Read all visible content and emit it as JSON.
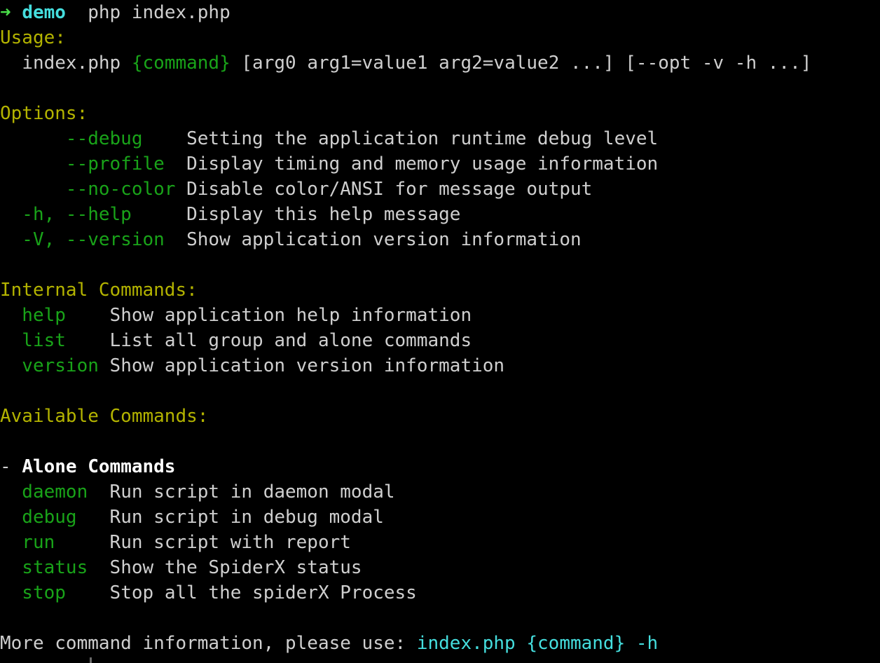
{
  "terminal": {
    "background": "#000000",
    "foreground": "#cfcfcf",
    "prompt": {
      "arrow_icon": "➜",
      "host": "demo",
      "command": "php index.php"
    },
    "cursor": {
      "visible": true,
      "color": "#6a6a6a"
    }
  },
  "colors": {
    "heading": "#b3b300",
    "flag": "#19a319",
    "command": "#19a319",
    "text": "#cfcfcf",
    "accent_cyan": "#45dede",
    "group_title": "#ffffff",
    "prompt_arrow": "#4ae04a",
    "prompt_host": "#45dede"
  },
  "usage": {
    "heading": "Usage:",
    "indent": "  ",
    "script": "index.php ",
    "command_token": "{command}",
    "args": " [arg0 arg1=value1 arg2=value2 ...] [--opt -v -h ...]"
  },
  "options": {
    "heading": "Options:",
    "items": [
      {
        "flags": "      --debug    ",
        "description": "Setting the application runtime debug level"
      },
      {
        "flags": "      --profile  ",
        "description": "Display timing and memory usage information"
      },
      {
        "flags": "      --no-color ",
        "description": "Disable color/ANSI for message output"
      },
      {
        "flags": "  -h, --help     ",
        "description": "Display this help message"
      },
      {
        "flags": "  -V, --version  ",
        "description": "Show application version information"
      }
    ]
  },
  "internal_commands": {
    "heading": "Internal Commands:",
    "items": [
      {
        "name": "  help    ",
        "description": "Show application help information"
      },
      {
        "name": "  list    ",
        "description": "List all group and alone commands"
      },
      {
        "name": "  version ",
        "description": "Show application version information"
      }
    ]
  },
  "available_commands": {
    "heading": "Available Commands:",
    "groups": [
      {
        "bullet": "- ",
        "title": "Alone Commands",
        "items": [
          {
            "name": "  daemon  ",
            "description": "Run script in daemon modal"
          },
          {
            "name": "  debug   ",
            "description": "Run script in debug modal"
          },
          {
            "name": "  run     ",
            "description": "Run script with report"
          },
          {
            "name": "  status  ",
            "description": "Show the SpiderX status"
          },
          {
            "name": "  stop    ",
            "description": "Stop all the spiderX Process"
          }
        ]
      }
    ]
  },
  "footer": {
    "text": "More command information, please use: ",
    "hint": "index.php {command} -h"
  }
}
